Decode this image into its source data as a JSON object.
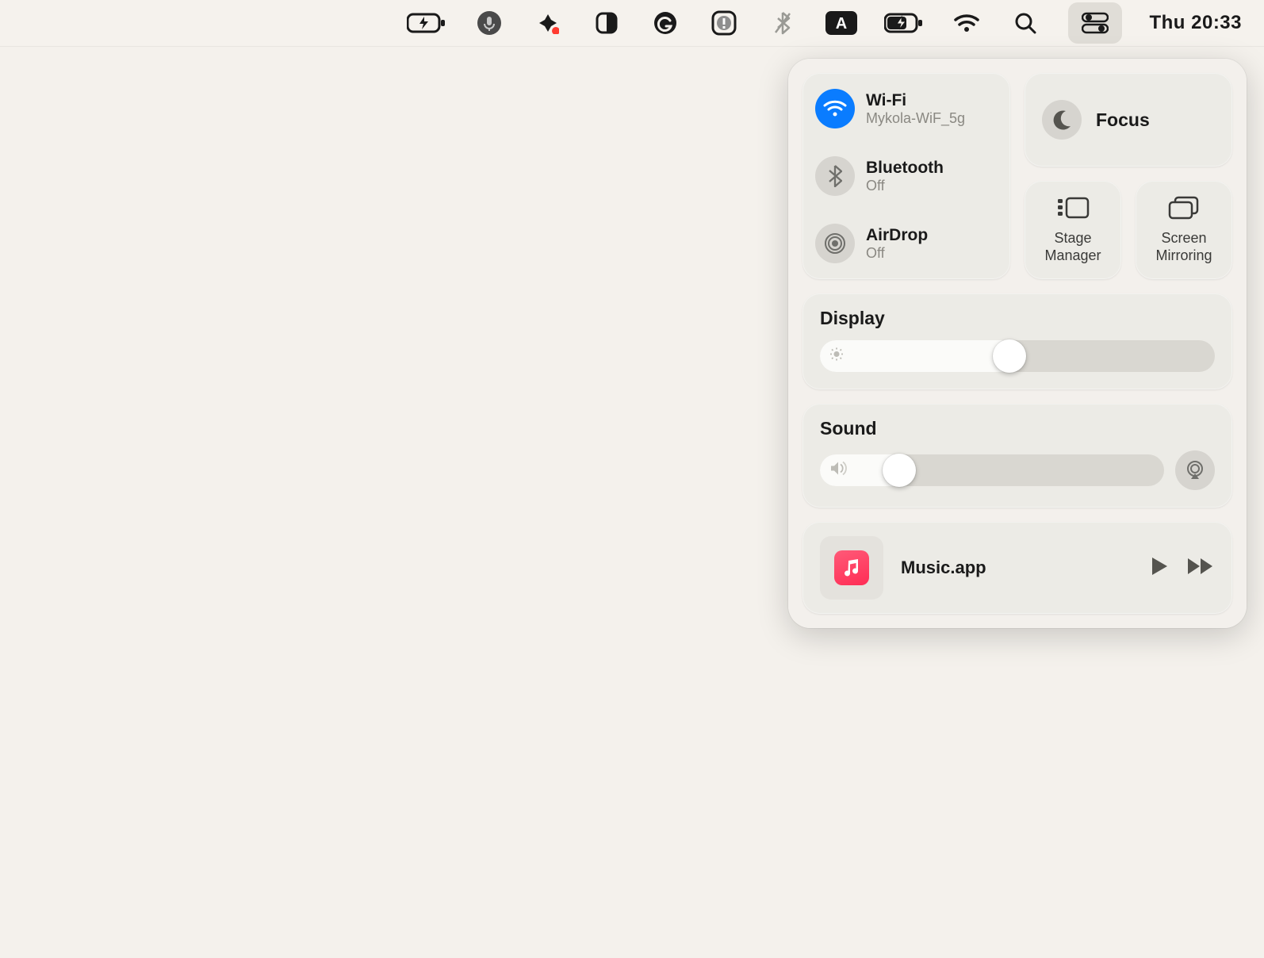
{
  "menubar": {
    "clock": "Thu 20:33"
  },
  "control_center": {
    "wifi": {
      "title": "Wi-Fi",
      "subtitle": "Mykola-WiF_5g",
      "active": true
    },
    "bluetooth": {
      "title": "Bluetooth",
      "subtitle": "Off",
      "active": false
    },
    "airdrop": {
      "title": "AirDrop",
      "subtitle": "Off",
      "active": false
    },
    "focus": {
      "title": "Focus",
      "active": false
    },
    "stage_manager": {
      "label": "Stage Manager"
    },
    "screen_mirroring": {
      "label": "Screen Mirroring"
    },
    "display": {
      "title": "Display",
      "value_percent": 48
    },
    "sound": {
      "title": "Sound",
      "value_percent": 23
    },
    "now_playing": {
      "app": "Music.app"
    }
  }
}
